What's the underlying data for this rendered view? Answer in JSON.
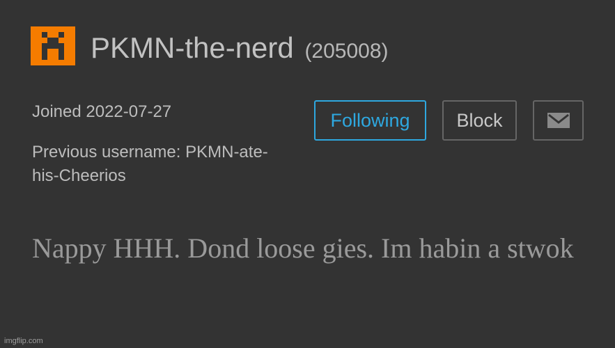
{
  "profile": {
    "avatar_icon": "pixel-creeper-icon",
    "avatar_color": "#f57c00",
    "username": "PKMN-the-nerd",
    "points": "(205008)",
    "joined": "Joined 2022-07-27",
    "previous_username": "Previous username: PKMN-ate-his-Cheerios",
    "bio": "Nappy HHH. Dond loose gies. Im habin a stwok"
  },
  "actions": {
    "following_label": "Following",
    "block_label": "Block",
    "message_icon": "envelope-icon",
    "accent_color": "#2ea8e0"
  },
  "watermark": "imgflip.com"
}
